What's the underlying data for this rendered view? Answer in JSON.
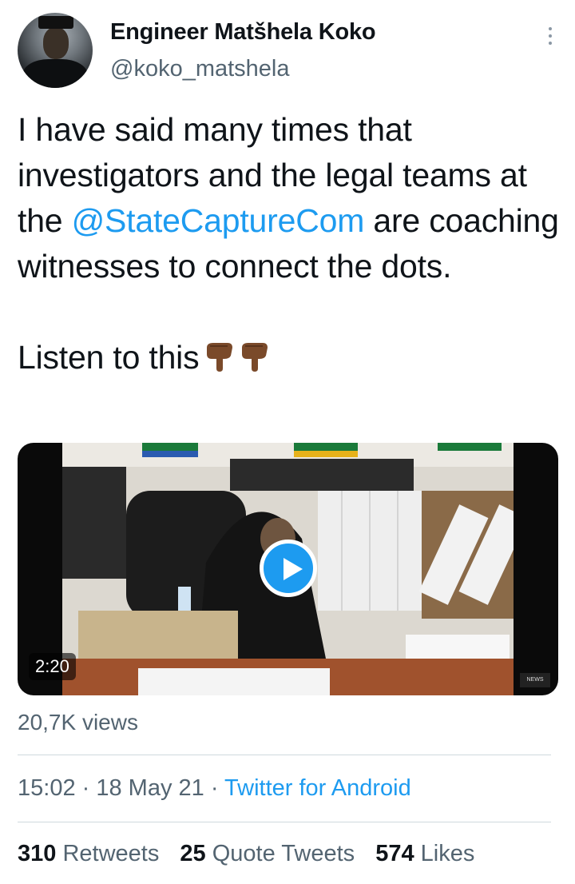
{
  "author": {
    "name": "Engineer Matšhela Koko",
    "handle": "@koko_matshela"
  },
  "tweet": {
    "text_before_mention": "I have said many times that investigators and the legal teams at the ",
    "mention": "@StateCaptureCom",
    "text_after_mention": " are coaching witnesses to connect the dots.",
    "second_line": "Listen to this",
    "emojis": [
      "backhand-index-pointing-down-icon",
      "backhand-index-pointing-down-icon"
    ]
  },
  "media": {
    "duration": "2:20",
    "play_icon": "play-icon"
  },
  "views": "20,7K views",
  "meta": {
    "time": "15:02",
    "separator": " · ",
    "date": "18 May 21",
    "source": "Twitter for Android"
  },
  "stats": {
    "retweets_count": "310",
    "retweets_label": "Retweets",
    "quotes_count": "25",
    "quotes_label": "Quote Tweets",
    "likes_count": "574",
    "likes_label": "Likes"
  },
  "colors": {
    "link": "#1d9bf0",
    "secondary_text": "#536471",
    "primary_text": "#0f1419",
    "divider": "#cfd9de"
  }
}
